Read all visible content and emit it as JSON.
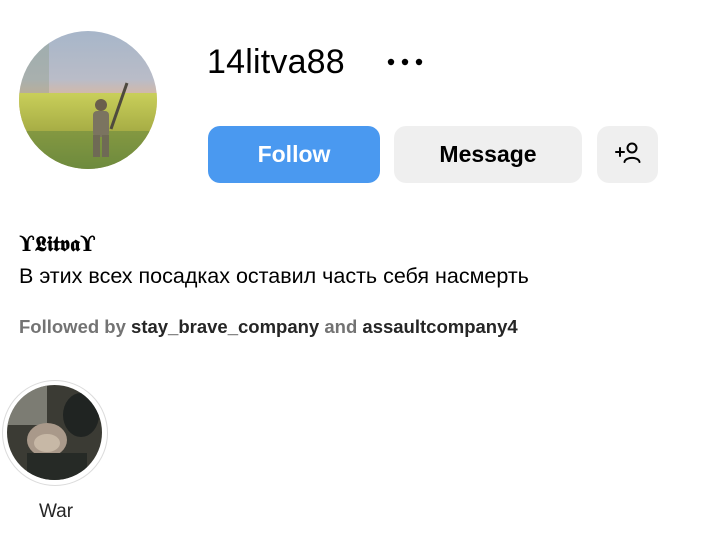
{
  "profile": {
    "username": "14litva88",
    "display_name": "ϒ𝕷𝖎𝖙𝖛𝖆ϒ",
    "bio": "В этих всех посадках оставил часть себя насмерть"
  },
  "actions": {
    "follow_label": "Follow",
    "message_label": "Message"
  },
  "followed_by": {
    "prefix": "Followed by",
    "account_1": "stay_brave_company",
    "joiner": "and",
    "account_2": "assaultcompany4"
  },
  "highlights": [
    {
      "label": "War"
    }
  ],
  "colors": {
    "follow_button": "#4a99f0",
    "secondary_button": "#efefef",
    "muted_text": "#737373"
  },
  "icons": {
    "more": "more-horizontal-icon",
    "add_user": "add-user-icon"
  }
}
